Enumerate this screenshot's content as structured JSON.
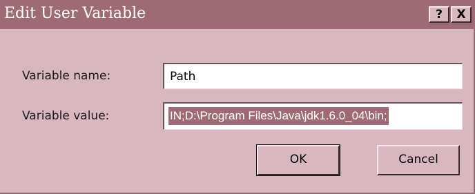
{
  "window": {
    "title": "Edit User Variable",
    "help_button": "?",
    "close_button": "X"
  },
  "form": {
    "name_label": "Variable name:",
    "name_value": "Path",
    "value_label": "Variable value:",
    "value_text": "IN;D:\\Program Files\\Java\\jdk1.6.0_04\\bin;"
  },
  "buttons": {
    "ok_label": "OK",
    "cancel_label": "Cancel"
  },
  "colors": {
    "titlebar": "#9e6a74",
    "dialog_background": "#d8b7c0",
    "selection": "#9e6a74"
  }
}
